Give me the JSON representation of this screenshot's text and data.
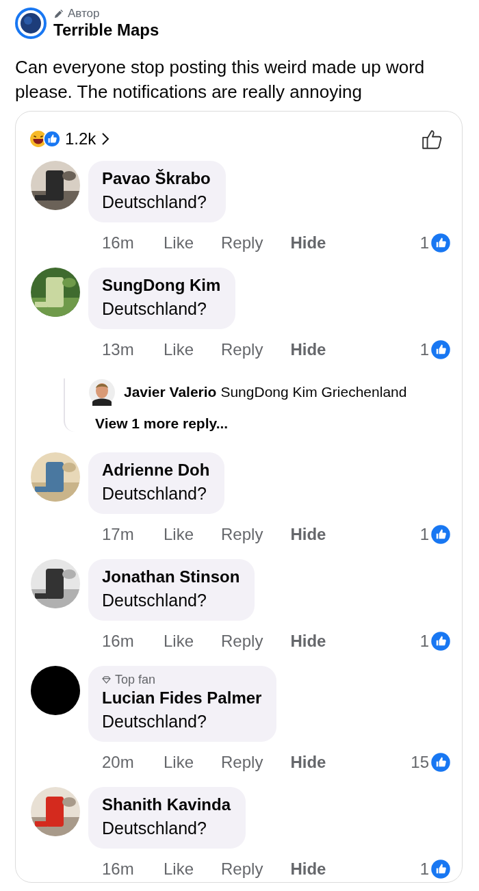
{
  "post": {
    "role": "Автор",
    "author": "Terrible Maps",
    "text": "Can everyone stop posting this weird made up word please. The notifications are really annoying"
  },
  "reactions": {
    "count": "1.2k"
  },
  "comments": [
    {
      "name": "Pavao Škrabo",
      "text": "Deutschland?",
      "time": "16m",
      "actions": [
        "Like",
        "Reply",
        "Hide"
      ],
      "likes": "1"
    },
    {
      "name": "SungDong Kim",
      "text": "Deutschland?",
      "time": "13m",
      "actions": [
        "Like",
        "Reply",
        "Hide"
      ],
      "likes": "1",
      "replies": [
        {
          "name": "Javier Valerio",
          "text": "SungDong Kim Griechenland"
        }
      ],
      "more_replies": "View 1 more reply..."
    },
    {
      "name": "Adrienne Doh",
      "text": "Deutschland?",
      "time": "17m",
      "actions": [
        "Like",
        "Reply",
        "Hide"
      ],
      "likes": "1"
    },
    {
      "name": "Jonathan Stinson",
      "text": "Deutschland?",
      "time": "16m",
      "actions": [
        "Like",
        "Reply",
        "Hide"
      ],
      "likes": "1"
    },
    {
      "badge": "Top fan",
      "name": "Lucian Fides Palmer",
      "text": "Deutschland?",
      "time": "20m",
      "actions": [
        "Like",
        "Reply",
        "Hide"
      ],
      "likes": "15",
      "avatar": {
        "kind": "black"
      }
    },
    {
      "name": "Shanith Kavinda",
      "text": "Deutschland?",
      "time": "16m",
      "actions": [
        "Like",
        "Reply",
        "Hide"
      ],
      "likes": "1"
    }
  ]
}
